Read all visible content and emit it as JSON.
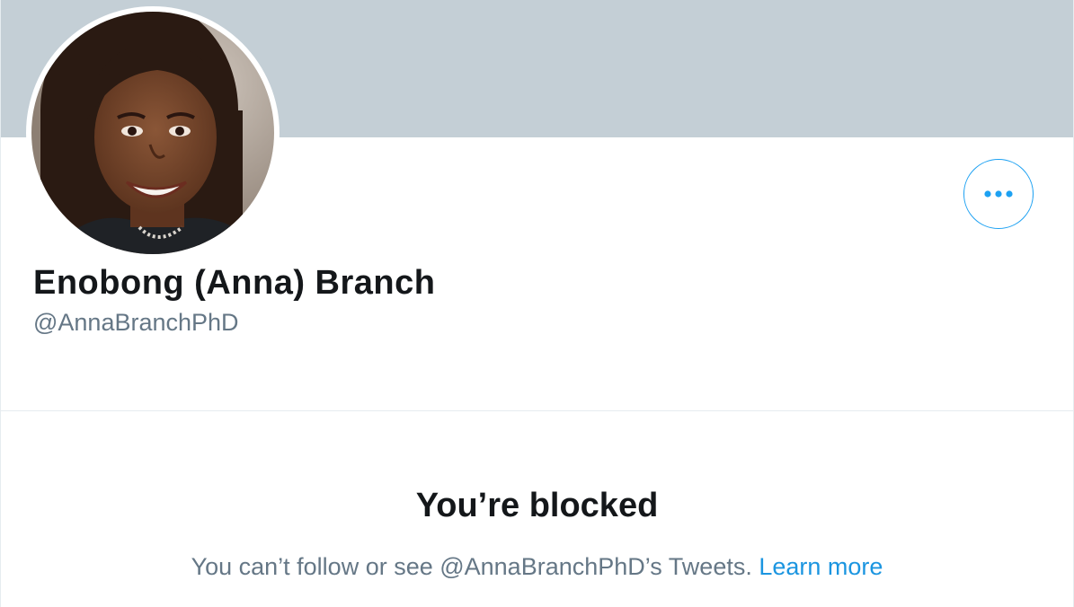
{
  "profile": {
    "display_name": "Enobong (Anna) Branch",
    "handle": "@AnnaBranchPhD"
  },
  "actions": {
    "more_icon": "more-horizontal-icon"
  },
  "blocked": {
    "title": "You’re blocked",
    "message": "You can’t follow or see @AnnaBranchPhD’s Tweets.",
    "learn_more": "Learn more"
  },
  "colors": {
    "banner": "#c4cfd6",
    "accent": "#1da1f2",
    "link": "#1b95e0",
    "primary_text": "#14171a",
    "secondary_text": "#657786"
  }
}
